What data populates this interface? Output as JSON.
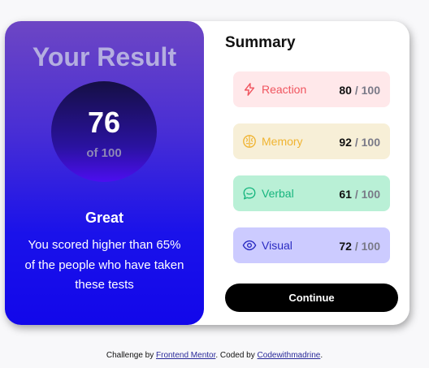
{
  "result": {
    "title": "Your Result",
    "score": "76",
    "score_of": "of 100",
    "rating": "Great",
    "message": "You scored higher than 65% of the people who have taken these tests"
  },
  "summary": {
    "title": "Summary",
    "items": [
      {
        "label": "Reaction",
        "score": "80",
        "max": "/ 100",
        "icon": "lightning-icon",
        "bg": "#ffe8ea",
        "color": "#f0555f"
      },
      {
        "label": "Memory",
        "score": "92",
        "max": "/ 100",
        "icon": "brain-icon",
        "bg": "#f7efd7",
        "color": "#f0b432"
      },
      {
        "label": "Verbal",
        "score": "61",
        "max": "/ 100",
        "icon": "chat-bubble-icon",
        "bg": "#b9f0d6",
        "color": "#16b57e"
      },
      {
        "label": "Visual",
        "score": "72",
        "max": "/ 100",
        "icon": "eye-icon",
        "bg": "#cccbff",
        "color": "#2a2bc2"
      }
    ],
    "continue_label": "Continue"
  },
  "attribution": {
    "prefix": "Challenge by",
    "link1": "Frontend Mentor",
    "middle": ". Coded by",
    "link2": "Codewithmadrine",
    "suffix": "."
  }
}
